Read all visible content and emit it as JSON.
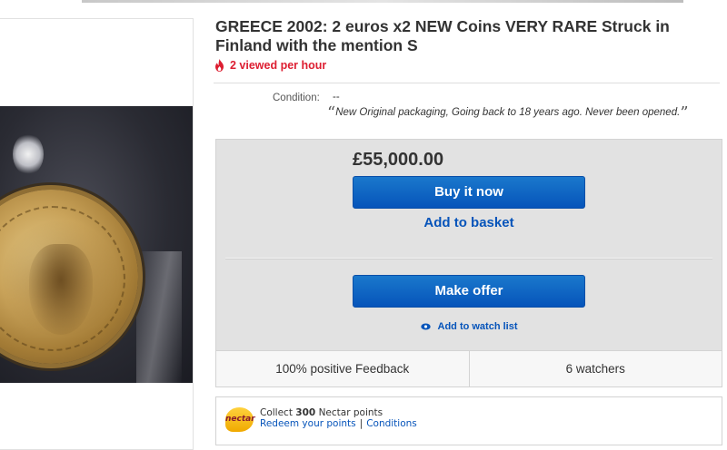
{
  "listing": {
    "title": "GREECE 2002: 2 euros x2 NEW Coins VERY RARE Struck in Finland with the mention S",
    "viewed": "2 viewed per hour"
  },
  "condition": {
    "label": "Condition:",
    "value": "--",
    "quote_open": "“",
    "quote": "New Original packaging, Going back to 18 years ago. Never been opened.",
    "quote_close": "”"
  },
  "buy_box": {
    "price": "£55,000.00",
    "buy_now_label": "Buy it now",
    "add_to_basket_label": "Add to basket",
    "make_offer_label": "Make offer",
    "watch_label": "Add to watch list"
  },
  "stats": {
    "feedback": "100% positive Feedback",
    "watchers": "6 watchers"
  },
  "nectar": {
    "logo_text": "nectar",
    "collect_prefix": "Collect",
    "points": "300",
    "collect_suffix": "Nectar points",
    "redeem_label": "Redeem your points",
    "separator": "|",
    "conditions_label": "Conditions"
  },
  "colors": {
    "accent_blue": "#0654ba",
    "alert_red": "#dd1e31",
    "box_gray": "#e2e2e2"
  },
  "icons": {
    "viewed": "flame-icon",
    "watch": "eye-icon",
    "nectar": "nectar-logo"
  }
}
